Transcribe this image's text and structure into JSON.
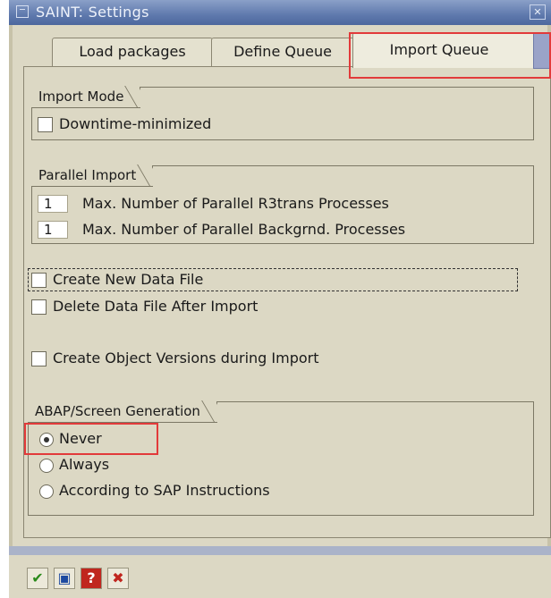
{
  "window": {
    "title": "SAINT: Settings"
  },
  "tabs": [
    {
      "label": "Load packages",
      "active": false
    },
    {
      "label": "Define Queue",
      "active": false
    },
    {
      "label": "Import Queue",
      "active": true
    }
  ],
  "import_mode": {
    "title": "Import Mode",
    "downtime_minimized": {
      "label": "Downtime-minimized",
      "checked": false
    }
  },
  "parallel_import": {
    "title": "Parallel Import",
    "r3trans": {
      "value": "1",
      "label": "Max. Number of Parallel R3trans Processes"
    },
    "backgrnd": {
      "value": "1",
      "label": "Max. Number of Parallel Backgrnd. Processes"
    }
  },
  "options": {
    "create_data_file": {
      "label": "Create New Data File",
      "checked": false
    },
    "delete_data_file": {
      "label": "Delete Data File After Import",
      "checked": false
    },
    "create_object_versions": {
      "label": "Create Object Versions during Import",
      "checked": false
    }
  },
  "generation": {
    "title": "ABAP/Screen Generation",
    "never": {
      "label": "Never",
      "selected": true
    },
    "always": {
      "label": "Always",
      "selected": false
    },
    "sap": {
      "label": "According to SAP Instructions",
      "selected": false
    }
  },
  "toolbar": {
    "continue_icon": "checkmark-icon",
    "save_icon": "save-icon",
    "help_icon": "help-icon",
    "cancel_icon": "cancel-icon"
  },
  "colors": {
    "highlight": "#e23a3a",
    "title_bar": "#5f79ad",
    "panel": "#dcd8c4"
  }
}
